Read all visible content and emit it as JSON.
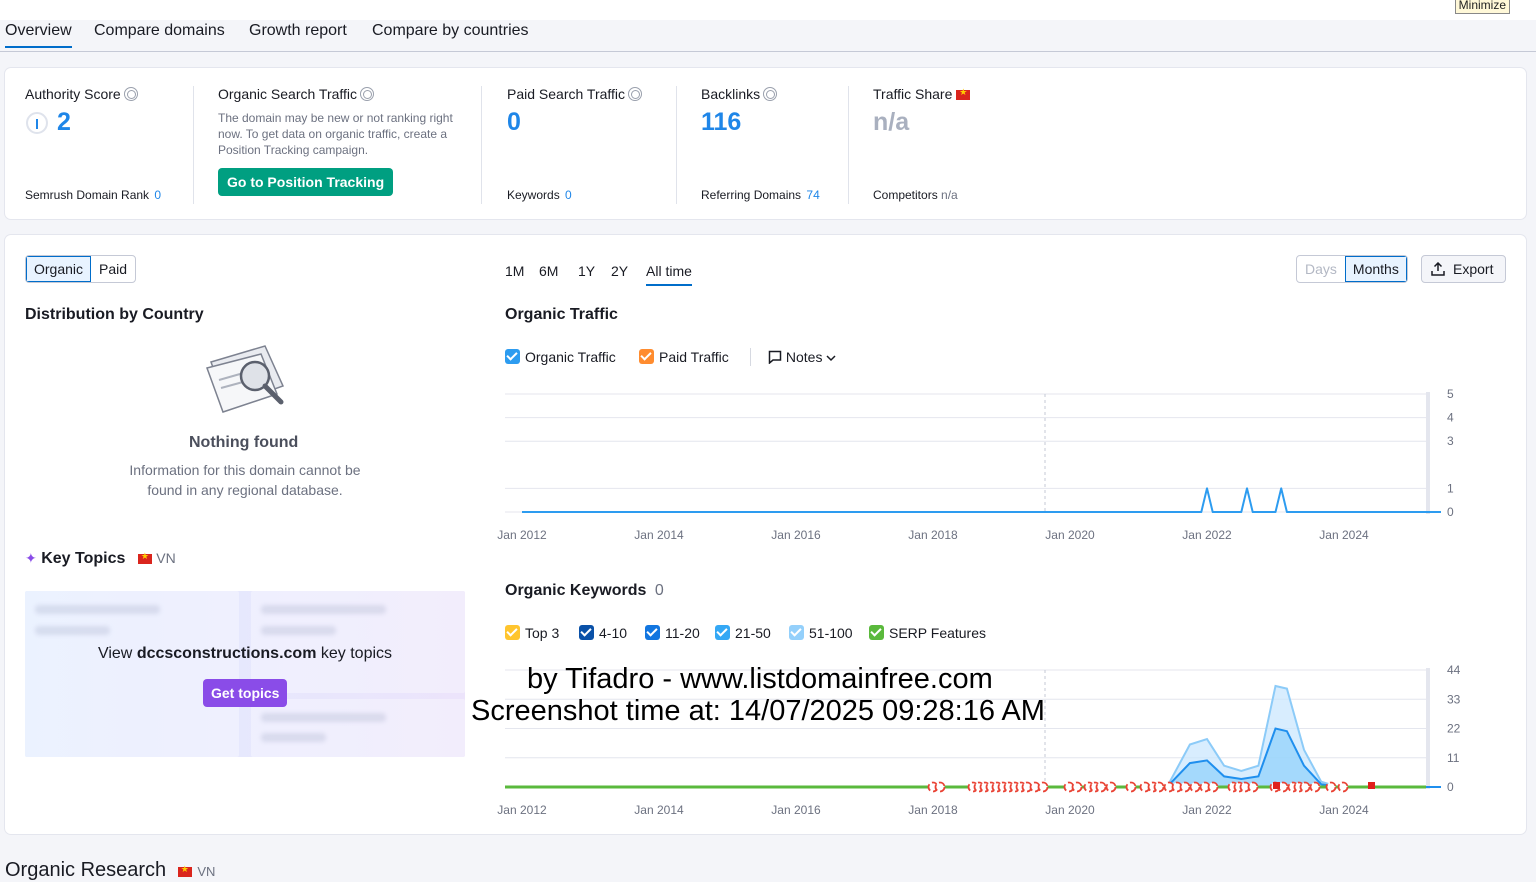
{
  "window": {
    "minimize_label": "Minimize"
  },
  "tabs": [
    {
      "label": "Overview",
      "active": true
    },
    {
      "label": "Compare domains"
    },
    {
      "label": "Growth report"
    },
    {
      "label": "Compare by countries"
    }
  ],
  "metrics": {
    "authority": {
      "title": "Authority Score",
      "value": "2",
      "sub_label": "Semrush Domain Rank",
      "sub_value": "0"
    },
    "organic": {
      "title": "Organic Search Traffic",
      "note": "The domain may be new or not ranking right now. To get data on organic traffic, create a Position Tracking campaign.",
      "button": "Go to Position Tracking"
    },
    "paid": {
      "title": "Paid Search Traffic",
      "value": "0",
      "sub_label": "Keywords",
      "sub_value": "0"
    },
    "backlinks": {
      "title": "Backlinks",
      "value": "116",
      "sub_label": "Referring Domains",
      "sub_value": "74"
    },
    "share": {
      "title": "Traffic Share",
      "value": "n/a",
      "sub_label": "Competitors",
      "sub_value": "n/a"
    }
  },
  "toggle": {
    "organic": "Organic",
    "paid": "Paid"
  },
  "periods": [
    "1M",
    "6M",
    "1Y",
    "2Y",
    "All time"
  ],
  "granularity": {
    "days": "Days",
    "months": "Months"
  },
  "export_label": "Export",
  "distribution": {
    "title": "Distribution by Country",
    "empty_title": "Nothing found",
    "empty_text": "Information for this domain cannot be found in any regional database."
  },
  "key_topics": {
    "title": "Key Topics",
    "country": "VN",
    "text_prefix": "View",
    "domain": "dccsconstructions.com",
    "text_suffix": "key topics",
    "button": "Get topics"
  },
  "traffic_legend": {
    "organic": "Organic Traffic",
    "paid": "Paid Traffic",
    "notes": "Notes"
  },
  "keywords_section": {
    "title": "Organic Keywords",
    "count": "0"
  },
  "keywords_legend": [
    "Top 3",
    "4-10",
    "11-20",
    "21-50",
    "51-100",
    "SERP Features"
  ],
  "colors": {
    "accent": "#006dca",
    "link": "#1f86e8",
    "green_button": "#009f81",
    "purple_button": "#8a4ce8"
  },
  "watermark": {
    "line1": "by Tifadro - www.listdomainfree.com",
    "line2": "Screenshot time at: 14/07/2025 09:28:16 AM"
  },
  "organic_research": {
    "title": "Organic Research",
    "country": "VN"
  },
  "chart_data": [
    {
      "type": "line",
      "title": "Organic Traffic",
      "x_ticks": [
        "Jan 2012",
        "Jan 2014",
        "Jan 2016",
        "Jan 2018",
        "Jan 2020",
        "Jan 2022",
        "Jan 2024"
      ],
      "y_ticks": [
        0,
        1,
        3,
        4,
        5
      ],
      "ylim": [
        0,
        5
      ],
      "series": [
        {
          "name": "Organic Traffic",
          "points": [
            [
              "Jan 2012",
              0
            ],
            [
              "Dec 2021",
              0
            ],
            [
              "Jan 2022",
              1
            ],
            [
              "Feb 2022",
              0
            ],
            [
              "Jul 2022",
              0
            ],
            [
              "Aug 2022",
              1
            ],
            [
              "Sep 2022",
              0
            ],
            [
              "Jan 2023",
              0
            ],
            [
              "Feb 2023",
              1
            ],
            [
              "Mar 2023",
              0
            ],
            [
              "Jun 2025",
              0
            ]
          ]
        }
      ]
    },
    {
      "type": "area",
      "title": "Organic Keywords",
      "x_ticks": [
        "Jan 2012",
        "Jan 2014",
        "Jan 2016",
        "Jan 2018",
        "Jan 2020",
        "Jan 2022",
        "Jan 2024"
      ],
      "y_ticks": [
        0,
        11,
        22,
        33,
        44
      ],
      "ylim": [
        0,
        44
      ],
      "series": [
        {
          "name": "Top 3",
          "points": []
        },
        {
          "name": "4-10",
          "points": []
        },
        {
          "name": "11-20",
          "points": []
        },
        {
          "name": "21-50",
          "points": [
            [
              "Jan 2012",
              0
            ],
            [
              "Jun 2021",
              0
            ],
            [
              "Oct 2021",
              9
            ],
            [
              "Jan 2022",
              10
            ],
            [
              "Apr 2022",
              4
            ],
            [
              "Jul 2022",
              3
            ],
            [
              "Oct 2022",
              4
            ],
            [
              "Jan 2023",
              22
            ],
            [
              "Mar 2023",
              21
            ],
            [
              "Jun 2023",
              8
            ],
            [
              "Sep 2023",
              1
            ],
            [
              "Dec 2023",
              0
            ],
            [
              "Jun 2025",
              0
            ]
          ]
        },
        {
          "name": "51-100",
          "points": [
            [
              "Jan 2012",
              0
            ],
            [
              "Jun 2021",
              0
            ],
            [
              "Oct 2021",
              16
            ],
            [
              "Jan 2022",
              18
            ],
            [
              "Apr 2022",
              8
            ],
            [
              "Jul 2022",
              6
            ],
            [
              "Oct 2022",
              8
            ],
            [
              "Jan 2023",
              38
            ],
            [
              "Mar 2023",
              37
            ],
            [
              "Jun 2023",
              14
            ],
            [
              "Sep 2023",
              2
            ],
            [
              "Dec 2023",
              0
            ],
            [
              "Jun 2025",
              0
            ]
          ]
        }
      ]
    }
  ]
}
